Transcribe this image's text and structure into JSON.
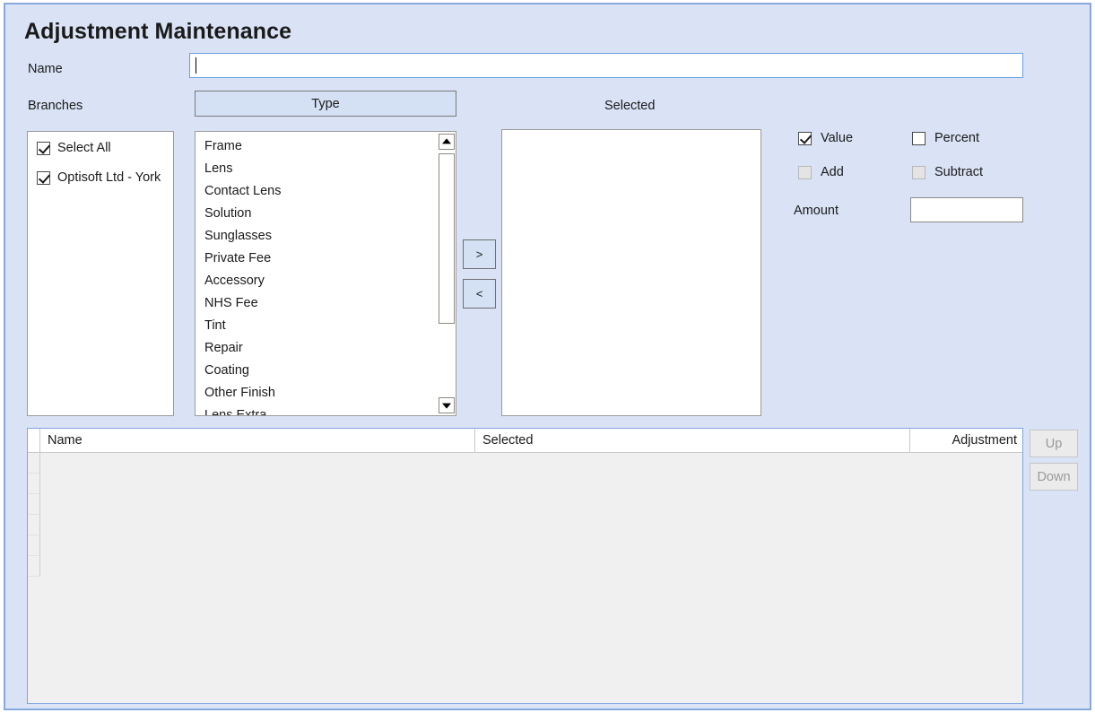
{
  "window": {
    "title": "Adjustment Maintenance",
    "background_color": "#d9e3f5",
    "border_color": "#88a8dd"
  },
  "form": {
    "name_label": "Name",
    "name_value": "",
    "name_placeholder": "",
    "branches_label": "Branches",
    "type_button_label": "Type",
    "selected_label": "Selected"
  },
  "branches": {
    "items": [
      {
        "label": "Select All",
        "checked": true
      },
      {
        "label": "Optisoft Ltd - York",
        "checked": true
      }
    ]
  },
  "type_list": {
    "items": [
      "Frame",
      "Lens",
      "Contact Lens",
      "Solution",
      "Sunglasses",
      "Private Fee",
      "Accessory",
      "NHS Fee",
      "Tint",
      "Repair",
      "Coating",
      "Other Finish",
      "Lens Extra"
    ],
    "scroll_up_icon": "triangle-up-icon",
    "scroll_down_icon": "triangle-down-icon"
  },
  "transfer": {
    "move_right_label": ">",
    "move_left_label": "<"
  },
  "selected_list": {
    "items": []
  },
  "options": {
    "value": {
      "label": "Value",
      "checked": true,
      "enabled": true
    },
    "percent": {
      "label": "Percent",
      "checked": false,
      "enabled": true
    },
    "add": {
      "label": "Add",
      "checked": false,
      "enabled": false
    },
    "subtract": {
      "label": "Subtract",
      "checked": false,
      "enabled": false
    },
    "amount_label": "Amount",
    "amount_value": ""
  },
  "grid": {
    "columns": [
      "Name",
      "Selected",
      "Adjustment"
    ],
    "rows": [],
    "empty_row_count": 6
  },
  "reorder": {
    "up_label": "Up",
    "down_label": "Down",
    "up_enabled": false,
    "down_enabled": false
  }
}
